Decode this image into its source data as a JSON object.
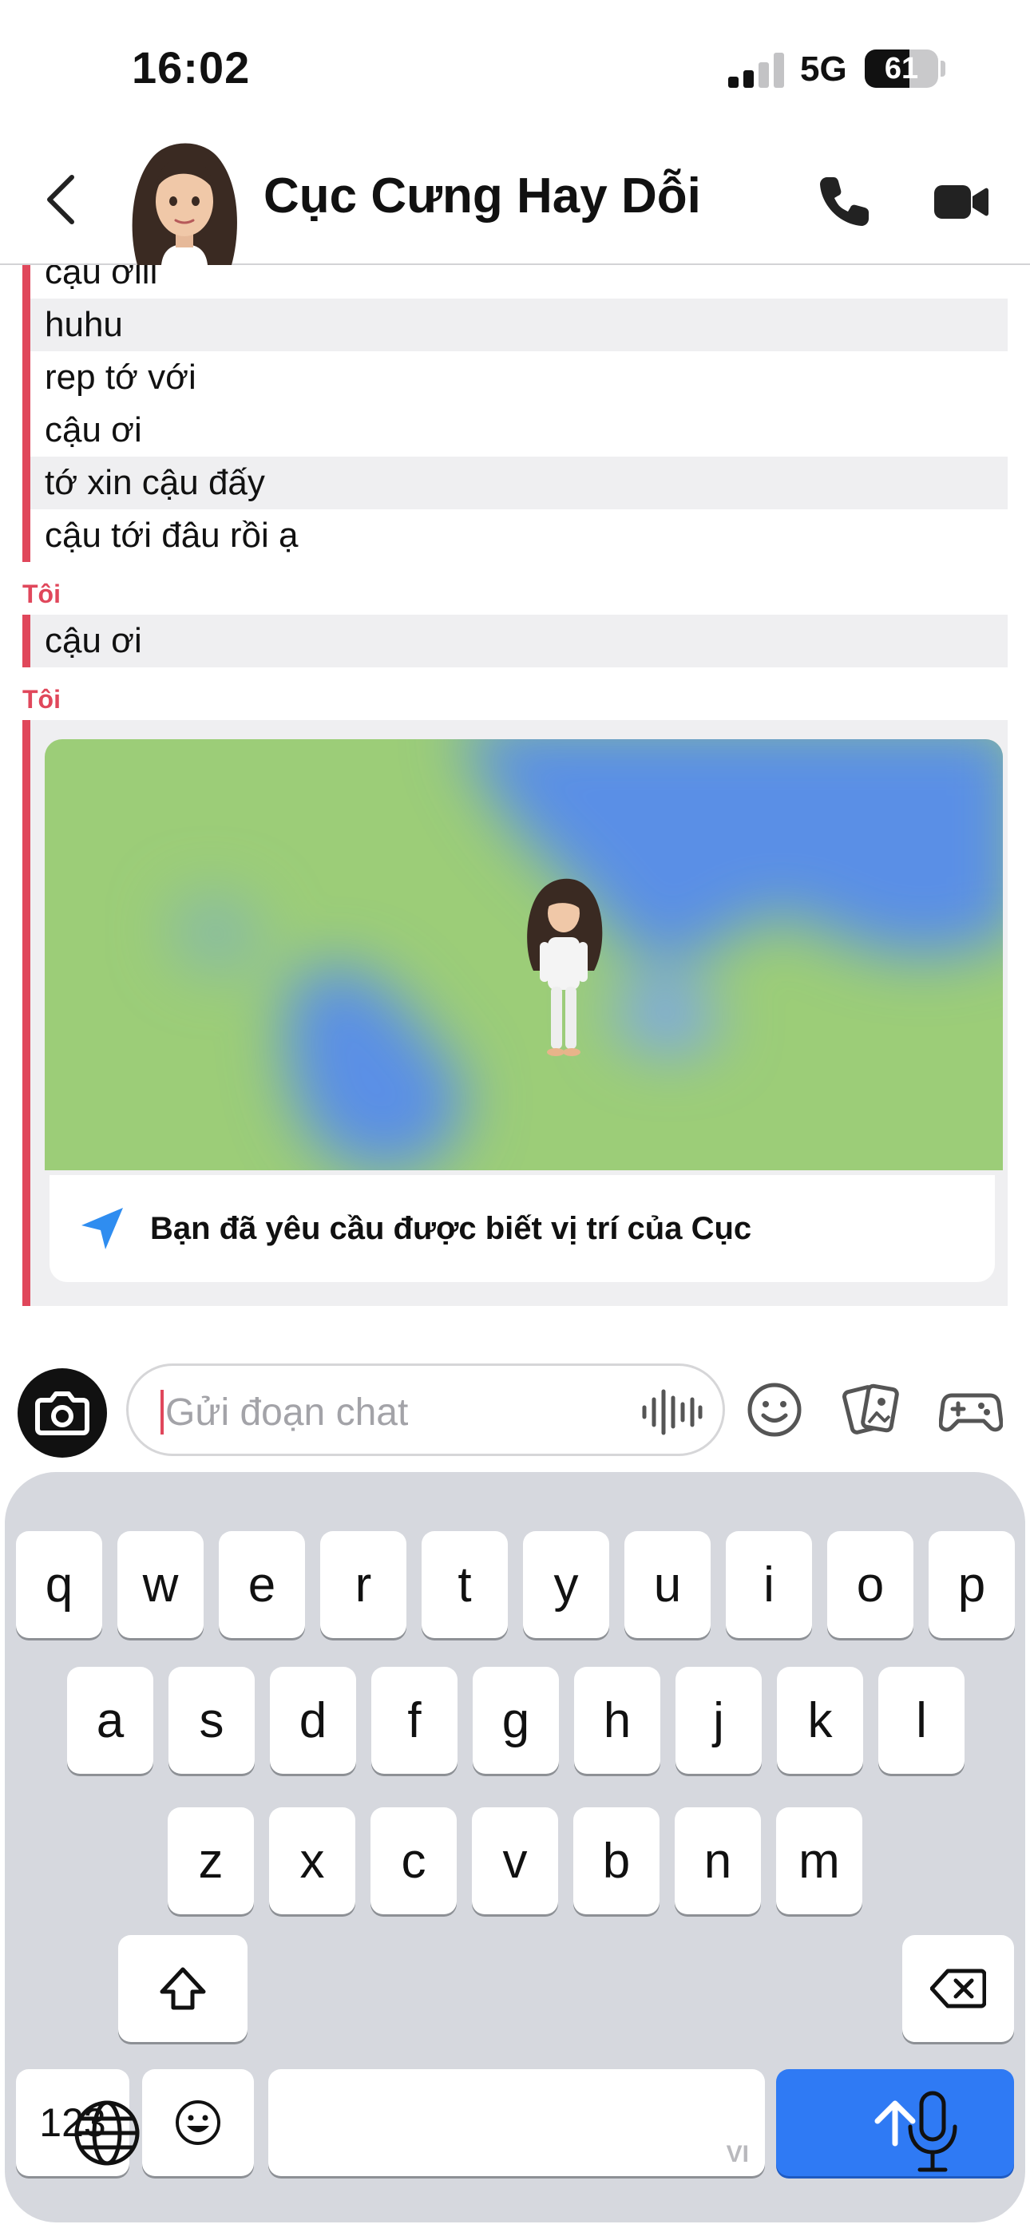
{
  "status_bar": {
    "time": "16:02",
    "network": "5G",
    "battery": 61
  },
  "header": {
    "contact_name": "Cục Cưng Hay Dỗi"
  },
  "messages": {
    "group1": [
      {
        "text": "cậu ơiii",
        "shaded": false
      },
      {
        "text": "huhu",
        "shaded": true
      },
      {
        "text": "rep tớ với",
        "shaded": false
      },
      {
        "text": "cậu ơi",
        "shaded": false
      },
      {
        "text": "tớ xin cậu đấy",
        "shaded": true
      },
      {
        "text": "cậu tới đâu rồi ạ",
        "shaded": false
      }
    ],
    "sender2": "Tôi",
    "group2": [
      {
        "text": "cậu ơi",
        "shaded": true
      }
    ],
    "sender3": "Tôi",
    "location_card": {
      "text": "Bạn đã yêu cầu được biết vị trí của Cục"
    }
  },
  "input": {
    "placeholder": "Gửi đoạn chat"
  },
  "keyboard": {
    "row1": [
      "q",
      "w",
      "e",
      "r",
      "t",
      "y",
      "u",
      "i",
      "o",
      "p"
    ],
    "row2": [
      "a",
      "s",
      "d",
      "f",
      "g",
      "h",
      "j",
      "k",
      "l"
    ],
    "row3": [
      "z",
      "x",
      "c",
      "v",
      "b",
      "n",
      "m"
    ],
    "numbers_key": "123",
    "language_tag": "VI"
  },
  "colors": {
    "accent": "#e0475b",
    "send": "#2f7af4",
    "map_green": "#9ccd78",
    "map_blue": "#5a8fe6"
  }
}
